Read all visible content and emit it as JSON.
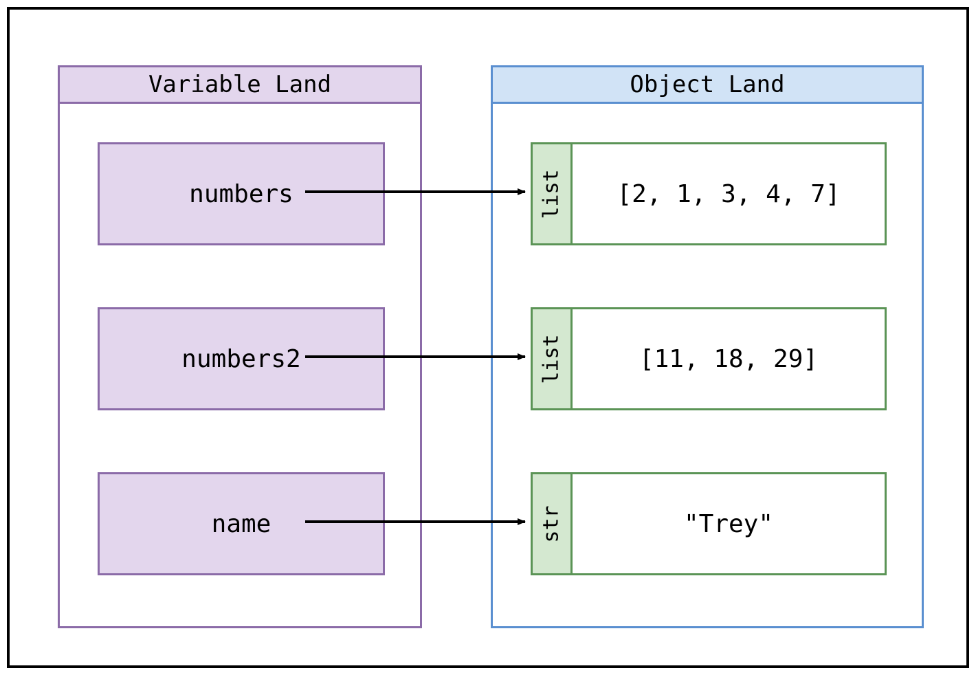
{
  "diagram": {
    "variable_panel_title": "Variable Land",
    "object_panel_title": "Object Land",
    "rows": [
      {
        "variable": "numbers",
        "type": "list",
        "value": "[2, 1, 3, 4, 7]"
      },
      {
        "variable": "numbers2",
        "type": "list",
        "value": "[11, 18, 29]"
      },
      {
        "variable": "name",
        "type": "str",
        "value": "\"Trey\""
      }
    ],
    "colors": {
      "variable_border": "#8b6ba8",
      "variable_fill": "#e3d6ed",
      "object_border": "#5a8fd0",
      "object_fill": "#d1e3f6",
      "type_border": "#5b9456",
      "type_fill": "#d4e8d0",
      "arrow": "#000000"
    }
  }
}
